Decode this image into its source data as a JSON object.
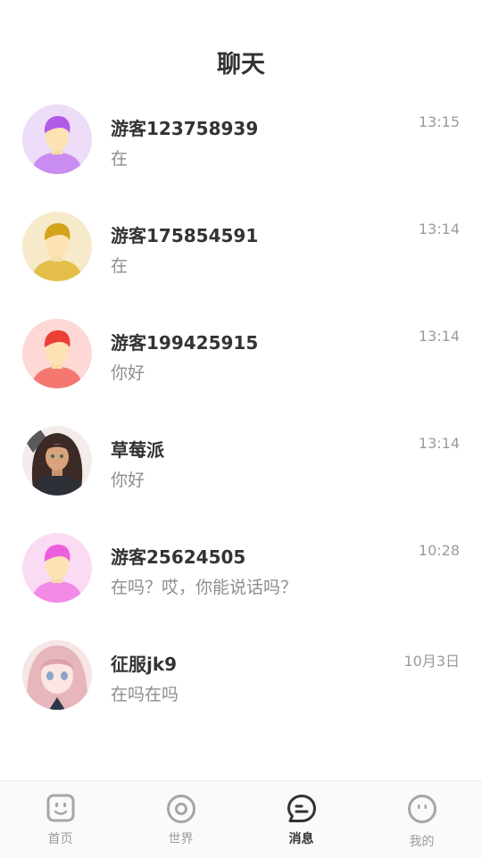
{
  "header": {
    "title": "聊天"
  },
  "chats": [
    {
      "name": "游客123758939",
      "message": "在",
      "time": "13:15",
      "avatar": "default-avatar-purple"
    },
    {
      "name": "游客175854591",
      "message": "在",
      "time": "13:14",
      "avatar": "default-avatar-yellow"
    },
    {
      "name": "游客199425915",
      "message": "你好",
      "time": "13:14",
      "avatar": "default-avatar-red"
    },
    {
      "name": "草莓派",
      "message": "你好",
      "time": "13:14",
      "avatar": "anime-girl-dark-hair"
    },
    {
      "name": "游客25624505",
      "message": "在吗？哎，你能说话吗？",
      "time": "10:28",
      "avatar": "default-avatar-pink"
    },
    {
      "name": "征服jk9",
      "message": "在吗在吗",
      "time": "10月3日",
      "avatar": "anime-girl-pink-hair"
    }
  ],
  "tabbar": {
    "tabs": [
      {
        "label": "首页",
        "icon": "home-icon"
      },
      {
        "label": "世界",
        "icon": "world-icon"
      },
      {
        "label": "消息",
        "icon": "message-icon",
        "active": true
      },
      {
        "label": "我的",
        "icon": "profile-icon"
      }
    ]
  }
}
